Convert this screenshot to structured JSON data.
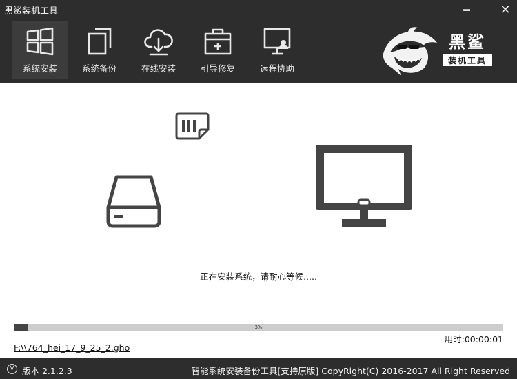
{
  "window": {
    "title": "黑鲨装机工具",
    "minimize_label": "━",
    "close_label": "✕"
  },
  "toolbar": {
    "items": [
      {
        "label": "系统安装",
        "icon": "windows-logo-icon",
        "active": true
      },
      {
        "label": "系统备份",
        "icon": "copy-icon",
        "active": false
      },
      {
        "label": "在线安装",
        "icon": "cloud-download-icon",
        "active": false
      },
      {
        "label": "引导修复",
        "icon": "toolbox-icon",
        "active": false
      },
      {
        "label": "远程协助",
        "icon": "remote-support-icon",
        "active": false
      }
    ]
  },
  "brand": {
    "logo_icon": "shark-mascot-icon",
    "name": "黑鲨",
    "subtitle": "装机工具"
  },
  "install": {
    "source_icon": "hard-drive-icon",
    "image_icon": "image-file-icon",
    "target_icon": "monitor-icon",
    "status": "正在安装系统，请耐心等候.....",
    "progress_percent": 3,
    "progress_text": "3%",
    "elapsed": "用时:00:00:01",
    "file_path": "F:\\\\764_hei_17_9_25_2.gho"
  },
  "statusbar": {
    "version_icon_glyph": "V",
    "version": "版本 2.1.2.3",
    "copyright": "智能系统安装备份工具[支持原版]  CopyRight(C) 2016-2017 All Right Reserved"
  },
  "colors": {
    "chrome_dark": "#2d2d2d",
    "active_tab": "#3c3c3c",
    "icon_dark": "#444444",
    "progress_track": "#cdcdcd"
  }
}
